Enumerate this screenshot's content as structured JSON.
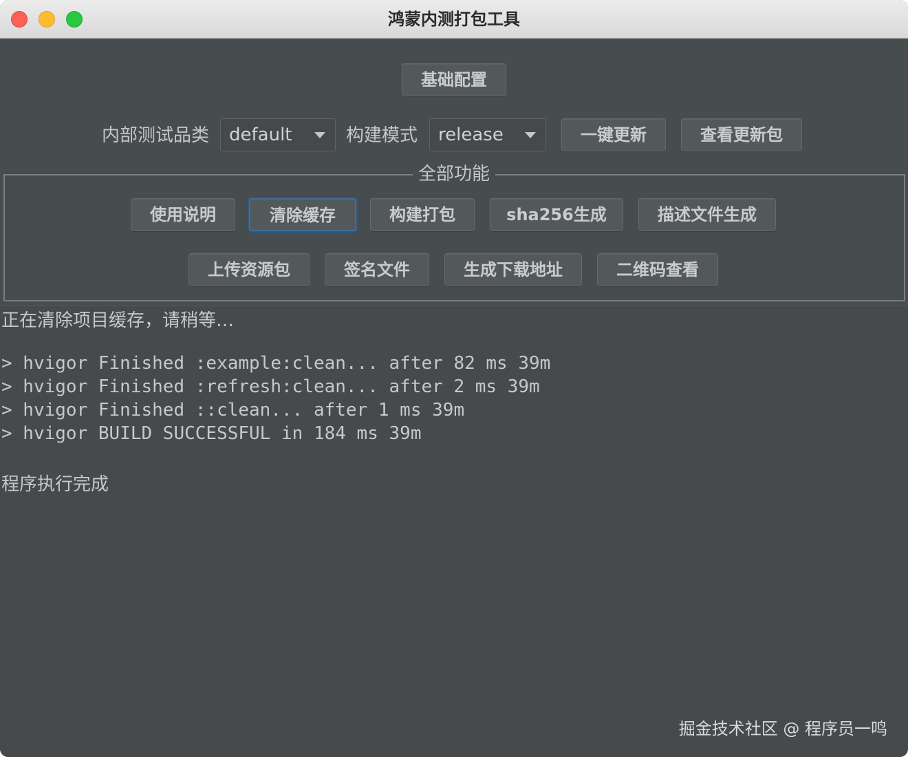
{
  "window": {
    "title": "鸿蒙内测打包工具"
  },
  "top": {
    "basic_config": "基础配置"
  },
  "settings": {
    "product_label": "内部测试品类",
    "product_value": "default",
    "mode_label": "构建模式",
    "mode_value": "release",
    "one_click_update": "一键更新",
    "view_update_pkg": "查看更新包"
  },
  "group": {
    "title": "全部功能",
    "row1": [
      "使用说明",
      "清除缓存",
      "构建打包",
      "sha256生成",
      "描述文件生成"
    ],
    "row2": [
      "上传资源包",
      "签名文件",
      "生成下载地址",
      "二维码查看"
    ]
  },
  "log": {
    "lines": [
      "正在清除项目缓存，请稍等…",
      "> hvigor Finished :example:clean... after 82 ms 39m",
      "> hvigor Finished :refresh:clean... after 2 ms 39m",
      "> hvigor Finished ::clean... after 1 ms 39m",
      "> hvigor BUILD SUCCESSFUL in 184 ms 39m",
      "程序执行完成"
    ]
  },
  "watermark": "掘金技术社区 @ 程序员一鸣"
}
